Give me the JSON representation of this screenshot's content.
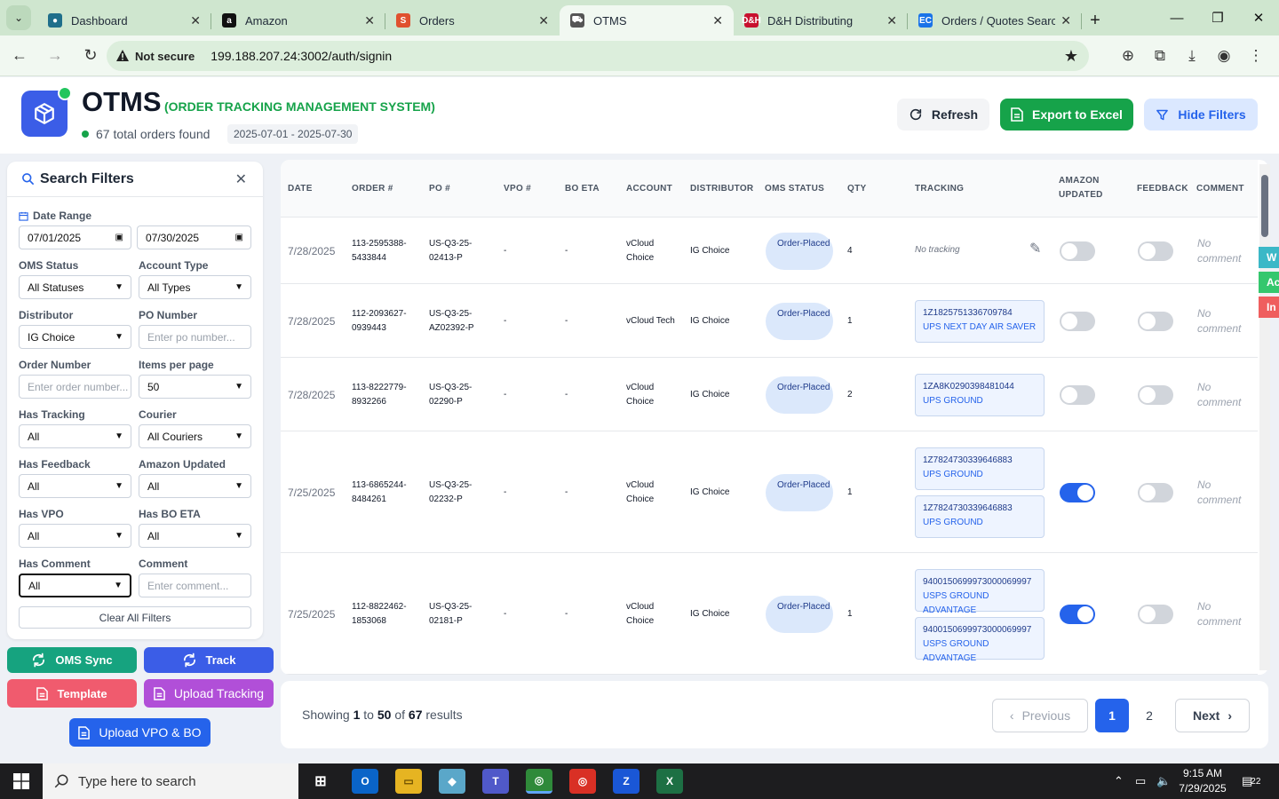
{
  "browser": {
    "tabs": [
      {
        "title": "Dashboard",
        "icon": "dashboard-favicon",
        "color": "#1f6f8b",
        "glyph": "●"
      },
      {
        "title": "Amazon",
        "icon": "amazon-favicon",
        "color": "#111111",
        "glyph": "a"
      },
      {
        "title": "Orders",
        "icon": "orders-favicon",
        "color": "#e0512f",
        "glyph": "S"
      },
      {
        "title": "OTMS",
        "icon": "otms-favicon",
        "color": "#555555",
        "glyph": "⛟"
      },
      {
        "title": "D&H Distributing",
        "icon": "dh-favicon",
        "color": "#c8102e",
        "glyph": "D&H"
      },
      {
        "title": "Orders / Quotes Search",
        "icon": "ec-favicon",
        "color": "#1a73e8",
        "glyph": "EC"
      }
    ],
    "url": "199.188.207.24:3002/auth/signin",
    "security": "Not secure"
  },
  "header": {
    "title": "OTMS",
    "subtitle": "(ORDER TRACKING MANAGEMENT SYSTEM)",
    "count_text": "67 total orders found",
    "date_range": "2025-07-01 - 2025-07-30",
    "refresh_label": "Refresh",
    "export_label": "Export to Excel",
    "hide_filters_label": "Hide Filters",
    "accent": "#3b5de7"
  },
  "filters": {
    "title": "Search Filters",
    "date_range_label": "Date Range",
    "date_from": "07/01/2025",
    "date_to": "07/30/2025",
    "oms_status_label": "OMS Status",
    "oms_status_value": "All Statuses",
    "account_type_label": "Account Type",
    "account_type_value": "All Types",
    "distributor_label": "Distributor",
    "distributor_value": "IG Choice",
    "po_number_label": "PO Number",
    "po_number_placeholder": "Enter po number...",
    "order_number_label": "Order Number",
    "order_number_placeholder": "Enter order number...",
    "items_per_page_label": "Items per page",
    "items_per_page_value": "50",
    "has_tracking_label": "Has Tracking",
    "has_tracking_value": "All",
    "courier_label": "Courier",
    "courier_value": "All Couriers",
    "has_feedback_label": "Has Feedback",
    "has_feedback_value": "All",
    "amazon_updated_label": "Amazon Updated",
    "amazon_updated_value": "All",
    "has_vpo_label": "Has VPO",
    "has_vpo_value": "All",
    "has_bo_eta_label": "Has BO ETA",
    "has_bo_eta_value": "All",
    "has_comment_label": "Has Comment",
    "has_comment_value": "All",
    "comment_label": "Comment",
    "comment_placeholder": "Enter comment...",
    "clear_label": "Clear All Filters"
  },
  "actions": {
    "oms_sync": "OMS Sync",
    "track": "Track",
    "template": "Template",
    "upload_tracking": "Upload Tracking",
    "upload_vpo_bo": "Upload VPO & BO"
  },
  "table": {
    "columns": [
      "DATE",
      "ORDER #",
      "PO #",
      "VPO #",
      "BO ETA",
      "ACCOUNT",
      "DISTRIBUTOR",
      "OMS STATUS",
      "QTY",
      "TRACKING",
      "AMAZON UPDATED",
      "FEEDBACK",
      "COMMENT"
    ],
    "rows": [
      {
        "date": "7/28/2025",
        "order": "113-2595388-5433844",
        "po": "US-Q3-25-02413-P",
        "vpo": "-",
        "bo": "-",
        "account": "vCloud Choice",
        "distributor": "IG Choice",
        "status": "Order-Placed",
        "qty": "4",
        "tracking": [],
        "no_tracking": "No tracking",
        "amazon_updated": false,
        "feedback": false,
        "comment": "No comment"
      },
      {
        "date": "7/28/2025",
        "order": "112-2093627-0939443",
        "po": "US-Q3-25-AZ02392-P",
        "vpo": "-",
        "bo": "-",
        "account": "vCloud Tech",
        "distributor": "IG Choice",
        "status": "Order-Placed",
        "qty": "1",
        "tracking": [
          {
            "number": "1Z1825751336709784",
            "courier": "UPS NEXT DAY AIR SAVER"
          }
        ],
        "amazon_updated": false,
        "feedback": false,
        "comment": "No comment"
      },
      {
        "date": "7/28/2025",
        "order": "113-8222779-8932266",
        "po": "US-Q3-25-02290-P",
        "vpo": "-",
        "bo": "-",
        "account": "vCloud Choice",
        "distributor": "IG Choice",
        "status": "Order-Placed",
        "qty": "2",
        "tracking": [
          {
            "number": "1ZA8K0290398481044",
            "courier": "UPS GROUND"
          }
        ],
        "amazon_updated": false,
        "feedback": false,
        "comment": "No comment"
      },
      {
        "date": "7/25/2025",
        "order": "113-6865244-8484261",
        "po": "US-Q3-25-02232-P",
        "vpo": "-",
        "bo": "-",
        "account": "vCloud Choice",
        "distributor": "IG Choice",
        "status": "Order-Placed",
        "qty": "1",
        "tracking": [
          {
            "number": "1Z7824730339646883",
            "courier": "UPS GROUND"
          },
          {
            "number": "1Z7824730339646883",
            "courier": "UPS GROUND"
          }
        ],
        "amazon_updated": true,
        "feedback": false,
        "comment": "No comment"
      },
      {
        "date": "7/25/2025",
        "order": "112-8822462-1853068",
        "po": "US-Q3-25-02181-P",
        "vpo": "-",
        "bo": "-",
        "account": "vCloud Choice",
        "distributor": "IG Choice",
        "status": "Order-Placed",
        "qty": "1",
        "tracking": [
          {
            "number": "9400150699973000069997",
            "courier": "USPS GROUND ADVANTAGE"
          },
          {
            "number": "9400150699973000069997",
            "courier": "USPS GROUND ADVANTAGE"
          }
        ],
        "amazon_updated": true,
        "feedback": false,
        "comment": "No comment"
      }
    ]
  },
  "side_tabs": [
    {
      "label": "W",
      "color": "#3bb8c7"
    },
    {
      "label": "Ac",
      "color": "#34c76d"
    },
    {
      "label": "In",
      "color": "#ef5e5e"
    }
  ],
  "pagination": {
    "showing_prefix": "Showing",
    "from": "1",
    "to_word": "to",
    "to": "50",
    "of_word": "of",
    "total": "67",
    "results_word": "results",
    "previous": "Previous",
    "next": "Next",
    "pages": [
      "1",
      "2"
    ]
  },
  "taskbar": {
    "search_placeholder": "Type here to search",
    "time": "9:15 AM",
    "date": "7/29/2025",
    "notifications": "22"
  }
}
